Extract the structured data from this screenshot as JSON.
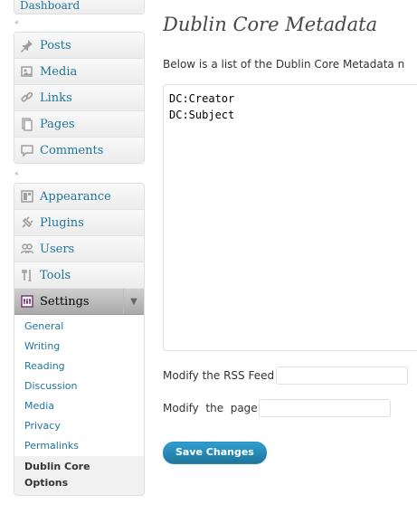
{
  "menu": {
    "top_item": {
      "label": "Dashboard"
    },
    "group1": [
      {
        "label": "Posts",
        "icon": "pushpin-icon"
      },
      {
        "label": "Media",
        "icon": "media-icon"
      },
      {
        "label": "Links",
        "icon": "link-icon"
      },
      {
        "label": "Pages",
        "icon": "pages-icon"
      },
      {
        "label": "Comments",
        "icon": "comment-icon"
      }
    ],
    "group2": [
      {
        "label": "Appearance",
        "icon": "appearance-icon"
      },
      {
        "label": "Plugins",
        "icon": "plugin-icon"
      },
      {
        "label": "Users",
        "icon": "users-icon"
      },
      {
        "label": "Tools",
        "icon": "tools-icon"
      }
    ],
    "settings": {
      "label": "Settings",
      "submenu": [
        "General",
        "Writing",
        "Reading",
        "Discussion",
        "Media",
        "Privacy",
        "Permalinks"
      ],
      "current": "Dublin Core Options"
    }
  },
  "main": {
    "title": "Dublin Core Metadata",
    "description": "Below is a list of the Dublin Core Metadata n",
    "metadata_text": "DC:Creator\nDC:Subject",
    "rss_label": "Modify the RSS Feed",
    "rss_value": "",
    "page_label": "Modify  the  page",
    "page_value": "",
    "save_button": "Save Changes"
  },
  "colors": {
    "link": "#21759b",
    "button": "#21759b",
    "settings_header": "#b4b4b4"
  }
}
